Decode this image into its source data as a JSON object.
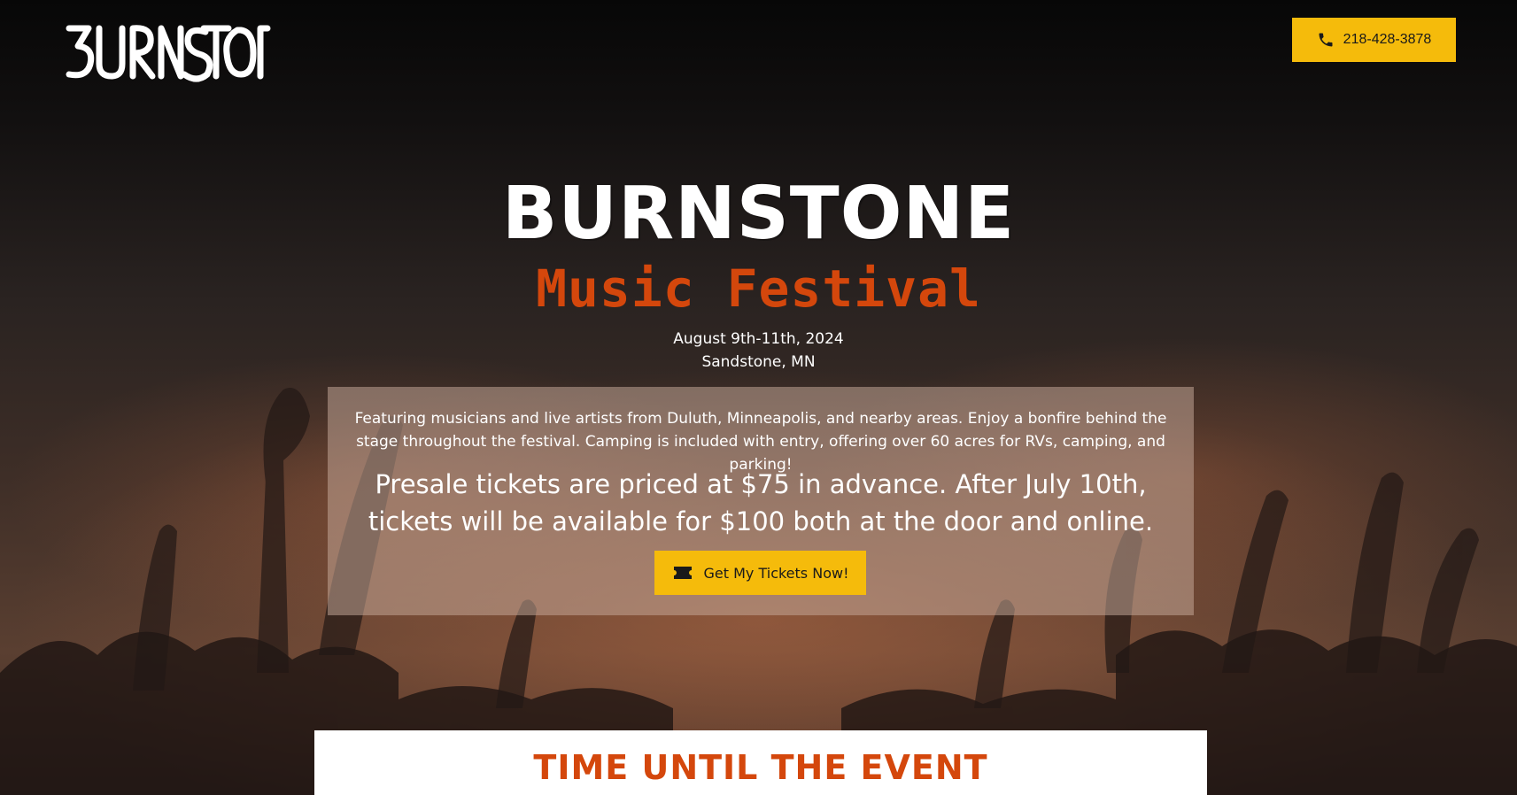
{
  "header": {
    "logo_text": "BURNSTONE",
    "phone_icon": "phone-icon",
    "phone_number": "218-428-3878"
  },
  "hero": {
    "title": "BURNSTONE",
    "subtitle": "Music Festival",
    "date": "August 9th-11th, 2024",
    "location": "Sandstone, MN"
  },
  "info": {
    "description": "Featuring musicians and live artists from Duluth, Minneapolis, and nearby areas. Enjoy a bonfire behind the stage throughout the festival. Camping is included with entry, offering over 60 acres for RVs, camping, and parking!",
    "pricing": "Presale tickets are priced at $75 in advance. After July 10th, tickets will be available for $100 both at the door and online.",
    "cta_icon": "ticket-icon",
    "cta_label": "Get My Tickets Now!"
  },
  "countdown": {
    "title": "TIME UNTIL THE EVENT"
  },
  "colors": {
    "accent_yellow": "#f5bb0b",
    "accent_orange": "#d4470c",
    "background": "#0a0908",
    "info_box": "rgba(200,170,155,0.52)"
  }
}
